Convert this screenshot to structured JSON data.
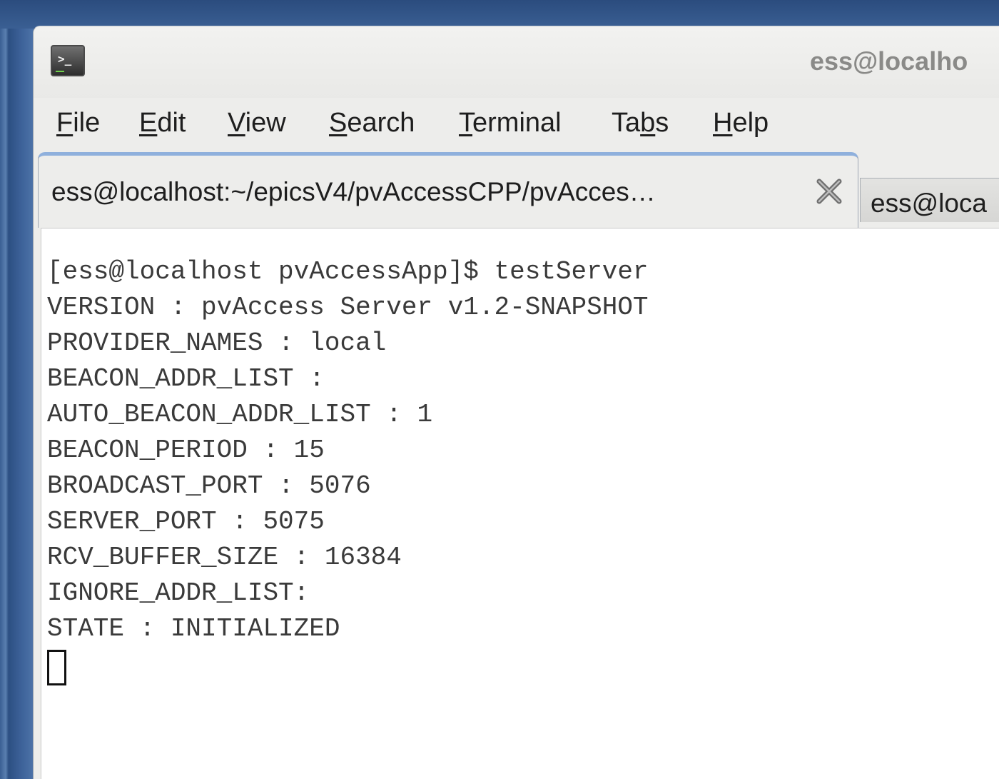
{
  "window": {
    "title": "ess@localho"
  },
  "menu": {
    "file": {
      "first": "F",
      "rest": "ile"
    },
    "edit": {
      "first": "E",
      "rest": "dit"
    },
    "view": {
      "first": "V",
      "rest": "iew"
    },
    "search": {
      "first": "S",
      "rest": "earch"
    },
    "terminal": {
      "first": "T",
      "rest": "erminal"
    },
    "tabs": {
      "before": "Ta",
      "u": "b",
      "after": "s"
    },
    "help": {
      "first": "H",
      "rest": "elp"
    }
  },
  "tabs": {
    "active_label": "ess@localhost:~/epicsV4/pvAccessCPP/pvAcces…",
    "inactive_label": "ess@loca"
  },
  "icons": {
    "app": "terminal-icon",
    "close": "close-icon"
  },
  "terminal": {
    "lines": [
      "[ess@localhost pvAccessApp]$ testServer",
      "VERSION : pvAccess Server v1.2-SNAPSHOT",
      "PROVIDER_NAMES : local",
      "BEACON_ADDR_LIST :",
      "AUTO_BEACON_ADDR_LIST : 1",
      "BEACON_PERIOD : 15",
      "BROADCAST_PORT : 5076",
      "SERVER_PORT : 5075",
      "RCV_BUFFER_SIZE : 16384",
      "IGNORE_ADDR_LIST:",
      "STATE : INITIALIZED"
    ]
  }
}
